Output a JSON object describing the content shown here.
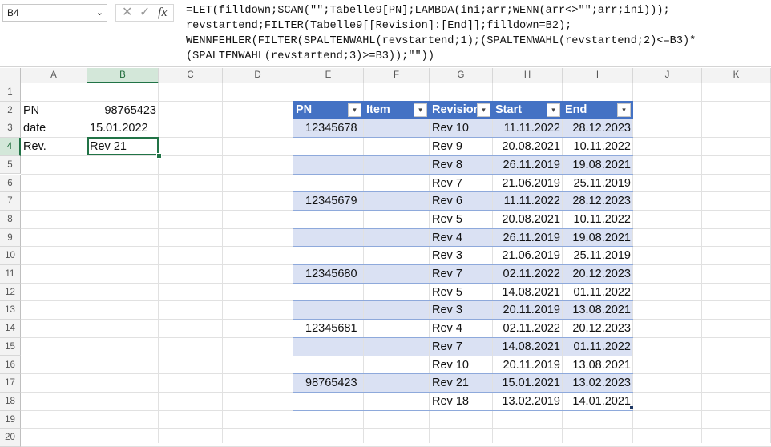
{
  "namebox": {
    "value": "B4"
  },
  "formula_bar": {
    "cancel_glyph": "✕",
    "enter_glyph": "✓",
    "fx_label": "fx",
    "lines": [
      "=LET(filldown;SCAN(\"\";Tabelle9[PN];LAMBDA(ini;arr;WENN(arr<>\"\";arr;ini)));",
      "revstartend;FILTER(Tabelle9[[Revision]:[End]];filldown=B2);",
      "WENNFEHLER(FILTER(SPALTENWAHL(revstartend;1);(SPALTENWAHL(revstartend;2)<=B3)*",
      "(SPALTENWAHL(revstartend;3)>=B3));\"\"))"
    ]
  },
  "columns": [
    "A",
    "B",
    "C",
    "D",
    "E",
    "F",
    "G",
    "H",
    "I",
    "J",
    "K"
  ],
  "rows": [
    "1",
    "2",
    "3",
    "4",
    "5",
    "6",
    "7",
    "8",
    "9",
    "10",
    "11",
    "12",
    "13",
    "14",
    "15",
    "16",
    "17",
    "18",
    "19",
    "20"
  ],
  "inputs": {
    "a2": "PN",
    "b2": "98765423",
    "a3": "date",
    "b3": "15.01.2022",
    "a4": "Rev.",
    "b4": "Rev 21"
  },
  "table": {
    "headers": [
      "PN",
      "Item",
      "Revision",
      "Start",
      "End"
    ],
    "rows": [
      [
        "12345678",
        "",
        "Rev 10",
        "11.11.2022",
        "28.12.2023"
      ],
      [
        "",
        "",
        "Rev 9",
        "20.08.2021",
        "10.11.2022"
      ],
      [
        "",
        "",
        "Rev 8",
        "26.11.2019",
        "19.08.2021"
      ],
      [
        "",
        "",
        "Rev 7",
        "21.06.2019",
        "25.11.2019"
      ],
      [
        "12345679",
        "",
        "Rev 6",
        "11.11.2022",
        "28.12.2023"
      ],
      [
        "",
        "",
        "Rev 5",
        "20.08.2021",
        "10.11.2022"
      ],
      [
        "",
        "",
        "Rev 4",
        "26.11.2019",
        "19.08.2021"
      ],
      [
        "",
        "",
        "Rev 3",
        "21.06.2019",
        "25.11.2019"
      ],
      [
        "12345680",
        "",
        "Rev 7",
        "02.11.2022",
        "20.12.2023"
      ],
      [
        "",
        "",
        "Rev 5",
        "14.08.2021",
        "01.11.2022"
      ],
      [
        "",
        "",
        "Rev 3",
        "20.11.2019",
        "13.08.2021"
      ],
      [
        "12345681",
        "",
        "Rev 4",
        "02.11.2022",
        "20.12.2023"
      ],
      [
        "",
        "",
        "Rev 7",
        "14.08.2021",
        "01.11.2022"
      ],
      [
        "",
        "",
        "Rev 10",
        "20.11.2019",
        "13.08.2021"
      ],
      [
        "98765423",
        "",
        "Rev 21",
        "15.01.2021",
        "13.02.2023"
      ],
      [
        "",
        "",
        "Rev 18",
        "13.02.2019",
        "14.01.2021"
      ]
    ]
  },
  "colors": {
    "table_header": "#4472c4",
    "band": "#dae1f3",
    "selection": "#217346"
  }
}
